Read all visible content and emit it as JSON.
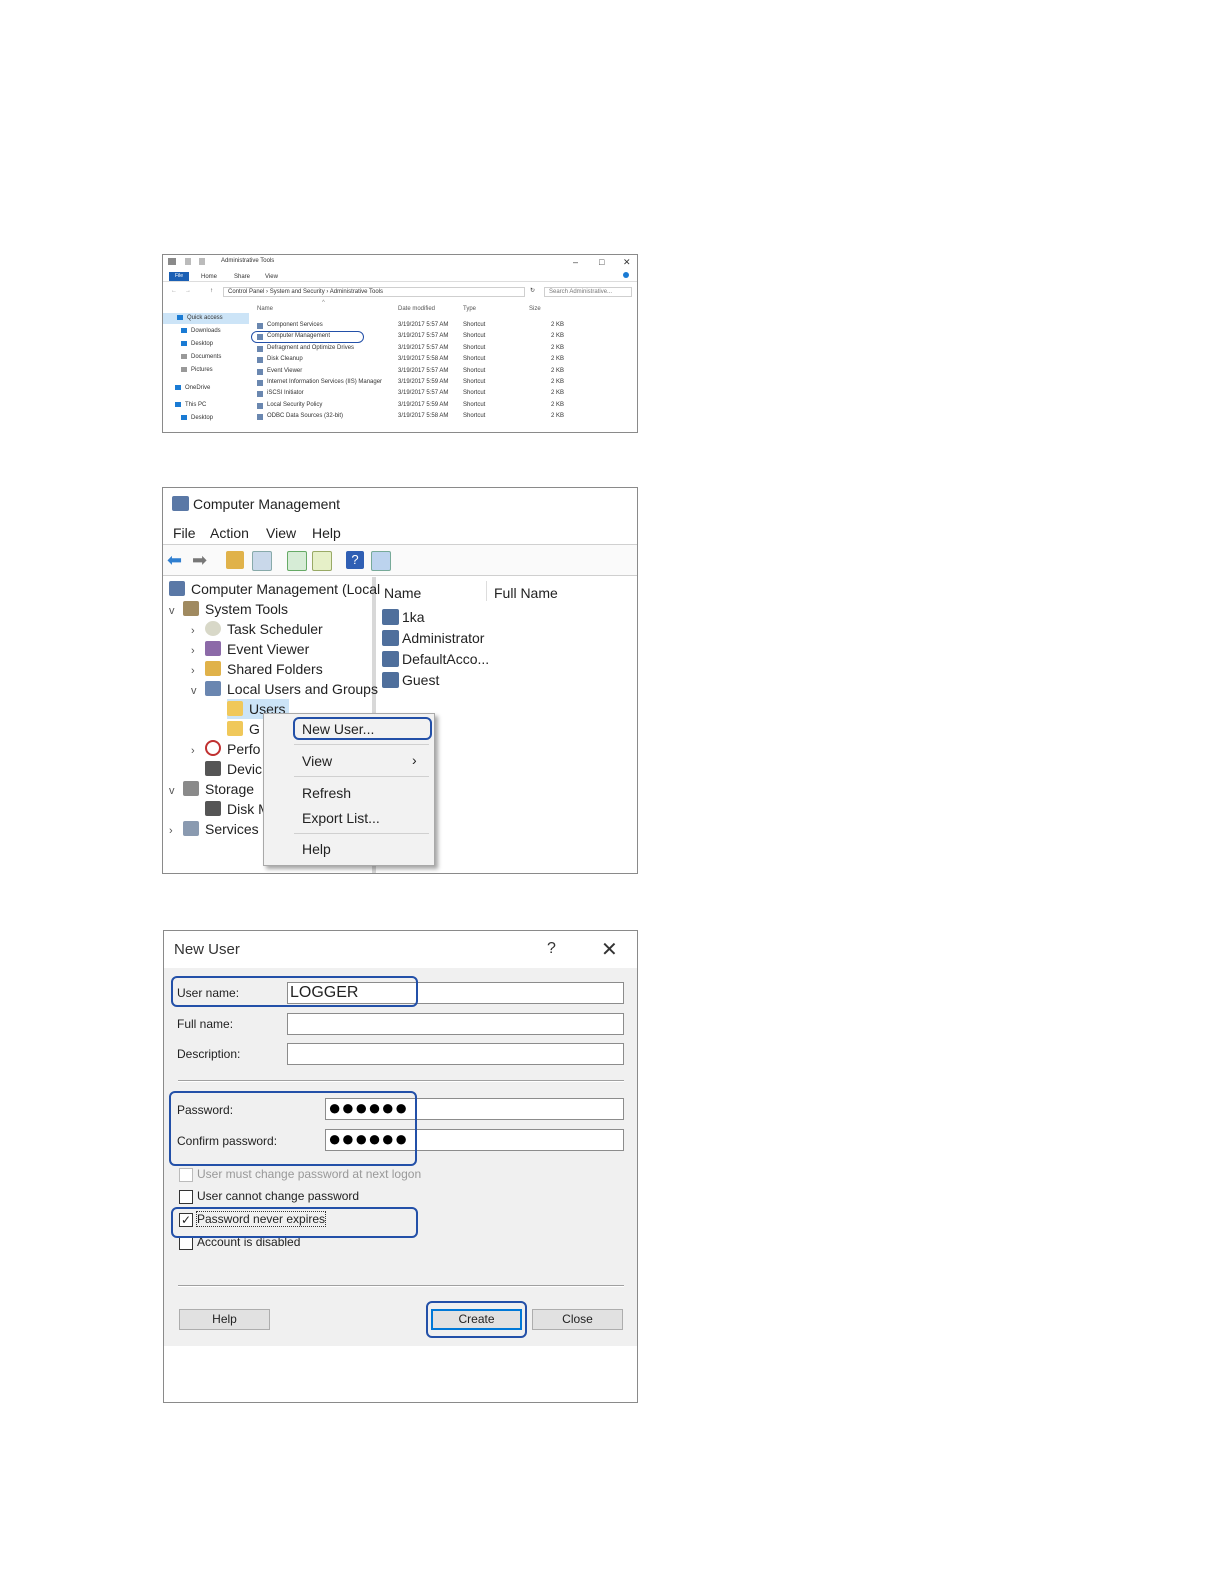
{
  "explorer": {
    "title": "Administrative Tools",
    "ribbon_tabs": [
      "File",
      "Home",
      "Share",
      "View"
    ],
    "address": [
      "Control Panel",
      "System and Security",
      "Administrative Tools"
    ],
    "search_placeholder": "Search Administrative...",
    "columns": [
      "Name",
      "Date modified",
      "Type",
      "Size"
    ],
    "nav": [
      "Quick access",
      "Downloads",
      "Desktop",
      "Documents",
      "Pictures",
      "OneDrive",
      "This PC",
      "Desktop"
    ],
    "rows": [
      {
        "name": "Component Services",
        "date": "3/19/2017 5:57 AM",
        "type": "Shortcut",
        "size": "2 KB"
      },
      {
        "name": "Computer Management",
        "date": "3/19/2017 5:57 AM",
        "type": "Shortcut",
        "size": "2 KB"
      },
      {
        "name": "Defragment and Optimize Drives",
        "date": "3/19/2017 5:57 AM",
        "type": "Shortcut",
        "size": "2 KB"
      },
      {
        "name": "Disk Cleanup",
        "date": "3/19/2017 5:58 AM",
        "type": "Shortcut",
        "size": "2 KB"
      },
      {
        "name": "Event Viewer",
        "date": "3/19/2017 5:57 AM",
        "type": "Shortcut",
        "size": "2 KB"
      },
      {
        "name": "Internet Information Services (IIS) Manager",
        "date": "3/19/2017 5:59 AM",
        "type": "Shortcut",
        "size": "2 KB"
      },
      {
        "name": "iSCSI Initiator",
        "date": "3/19/2017 5:57 AM",
        "type": "Shortcut",
        "size": "2 KB"
      },
      {
        "name": "Local Security Policy",
        "date": "3/19/2017 5:59 AM",
        "type": "Shortcut",
        "size": "2 KB"
      },
      {
        "name": "ODBC Data Sources (32-bit)",
        "date": "3/19/2017 5:58 AM",
        "type": "Shortcut",
        "size": "2 KB"
      }
    ]
  },
  "compmgmt": {
    "title": "Computer Management",
    "menu": [
      "File",
      "Action",
      "View",
      "Help"
    ],
    "tree": {
      "root": "Computer Management (Local",
      "system_tools": "System Tools",
      "task_scheduler": "Task Scheduler",
      "event_viewer": "Event Viewer",
      "shared_folders": "Shared Folders",
      "local_users": "Local Users and Groups",
      "users": "Users",
      "groups": "G",
      "performance": "Perfo",
      "device": "Devic",
      "storage": "Storage",
      "disk": "Disk M",
      "services": "Services a"
    },
    "columns": [
      "Name",
      "Full Name"
    ],
    "users": [
      "1ka",
      "Administrator",
      "DefaultAcco...",
      "Guest"
    ],
    "context_menu": {
      "new_user": "New User...",
      "view": "View",
      "refresh": "Refresh",
      "export": "Export List...",
      "help": "Help"
    }
  },
  "newuser": {
    "title": "New User",
    "help_glyph": "?",
    "close_glyph": "✕",
    "labels": {
      "username": "User name:",
      "fullname": "Full name:",
      "description": "Description:",
      "password": "Password:",
      "confirm": "Confirm password:"
    },
    "username_value": "LOGGER",
    "password_mask": "●●●●●●",
    "confirm_mask": "●●●●●●",
    "checkboxes": [
      {
        "label": "User must change password at next logon",
        "checked": false
      },
      {
        "label": "User cannot change password",
        "checked": false
      },
      {
        "label": "Password never expires",
        "checked": true
      },
      {
        "label": "Account is disabled",
        "checked": false
      }
    ],
    "buttons": {
      "help": "Help",
      "create": "Create",
      "close": "Close"
    }
  }
}
